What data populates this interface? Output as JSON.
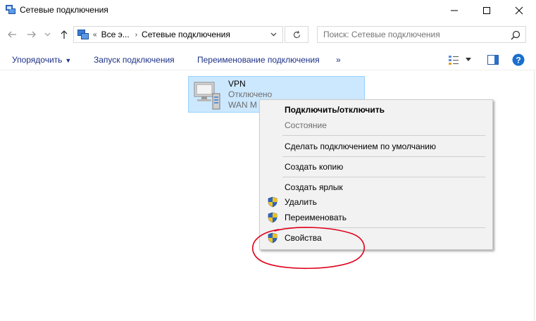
{
  "window": {
    "title": "Сетевые подключения"
  },
  "address": {
    "chevron": "«",
    "segment1": "Все э...",
    "segment2": "Сетевые подключения"
  },
  "search": {
    "placeholder": "Поиск: Сетевые подключения"
  },
  "commands": {
    "organize": "Упорядочить",
    "start_connection": "Запуск подключения",
    "rename_connection": "Переименование подключения",
    "more": "»"
  },
  "connection": {
    "name": "VPN",
    "status": "Отключено",
    "device": "WAN Mi",
    "selected": true
  },
  "context_menu": {
    "items": [
      {
        "label": "Подключить/отключить",
        "bold": true,
        "disabled": false,
        "shield": false
      },
      {
        "label": "Состояние",
        "bold": false,
        "disabled": true,
        "shield": false
      },
      {
        "label": "Сделать подключением по умолчанию",
        "bold": false,
        "disabled": false,
        "shield": false
      },
      {
        "label": "Создать копию",
        "bold": false,
        "disabled": false,
        "shield": false
      },
      {
        "label": "Создать ярлык",
        "bold": false,
        "disabled": false,
        "shield": false
      },
      {
        "label": "Удалить",
        "bold": false,
        "disabled": false,
        "shield": true
      },
      {
        "label": "Переименовать",
        "bold": false,
        "disabled": false,
        "shield": true
      },
      {
        "label": "Свойства",
        "bold": false,
        "disabled": false,
        "shield": true
      }
    ]
  },
  "colors": {
    "accent_text": "#1e3287",
    "selection_bg": "#cce8ff",
    "annotation": "#e0001b",
    "help": "#1a6fce"
  },
  "icons": {
    "window": "network-connections-icon",
    "back": "back-arrow-icon",
    "forward": "forward-arrow-icon",
    "up": "up-arrow-icon",
    "refresh": "refresh-icon",
    "search": "search-icon",
    "shield": "uac-shield-icon",
    "help": "help-icon"
  }
}
